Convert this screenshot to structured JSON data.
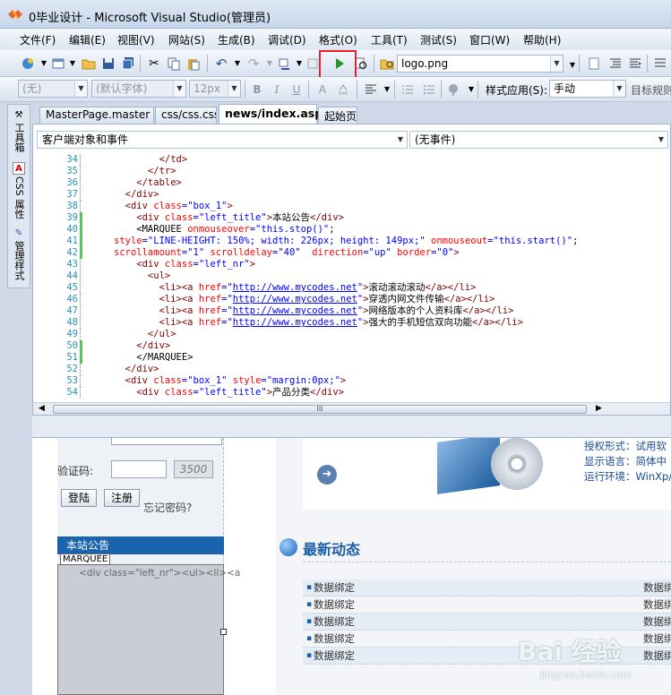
{
  "window": {
    "title": "0毕业设计 - Microsoft Visual Studio(管理员)"
  },
  "menu": {
    "items": [
      "文件(F)",
      "编辑(E)",
      "视图(V)",
      "网站(S)",
      "生成(B)",
      "调试(D)",
      "格式(O)",
      "工具(T)",
      "测试(S)",
      "窗口(W)",
      "帮助(H)"
    ]
  },
  "toolbar1": {
    "file_combo": "logo.png"
  },
  "toolbar2": {
    "block_combo": "(无)",
    "font_combo": "(默认字体)",
    "size_combo": "12px",
    "style_apply_label": "样式应用(S):",
    "style_apply_value": "手动",
    "target_rules_label": "目标规则"
  },
  "left_tabs": {
    "toolbox": "工具箱",
    "css_props": "CSS 属性",
    "manage_styles": "管理样式"
  },
  "doc_tabs": [
    "MasterPage.master",
    "css/css.css",
    "news/index.aspx",
    "起始页"
  ],
  "editor": {
    "object_combo": "客户端对象和事件",
    "event_combo": "(无事件)"
  },
  "code_lines": [
    {
      "n": "34",
      "parts": [
        {
          "c": "t",
          "s": "        </td>"
        }
      ]
    },
    {
      "n": "35",
      "parts": [
        {
          "c": "t",
          "s": "      </tr>"
        }
      ]
    },
    {
      "n": "36",
      "parts": [
        {
          "c": "t",
          "s": "    </table>"
        }
      ]
    },
    {
      "n": "37",
      "parts": [
        {
          "c": "t",
          "s": "  </div>"
        }
      ]
    },
    {
      "n": "38",
      "parts": [
        {
          "c": "t",
          "s": "  <div "
        },
        {
          "c": "a",
          "s": "class"
        },
        {
          "c": "v",
          "s": "=\"box_1\""
        },
        {
          "c": "t",
          "s": ">"
        }
      ]
    },
    {
      "n": "39",
      "parts": [
        {
          "c": "t",
          "s": "    <div "
        },
        {
          "c": "a",
          "s": "class"
        },
        {
          "c": "v",
          "s": "=\"left_title\""
        },
        {
          "c": "t",
          "s": ">"
        },
        {
          "c": "",
          "s": "本站公告"
        },
        {
          "c": "t",
          "s": "</div>"
        }
      ]
    },
    {
      "n": "40",
      "parts": [
        {
          "c": "",
          "s": "    <MARQUEE "
        },
        {
          "c": "a",
          "s": "onmouseover"
        },
        {
          "c": "v",
          "s": "=\"this.stop()\""
        },
        {
          "c": "",
          "s": ";"
        }
      ]
    },
    {
      "n": "41",
      "parts": [
        {
          "c": "a",
          "s": "style"
        },
        {
          "c": "v",
          "s": "=\"LINE-HEIGHT: 150%; width: 226px; height: 149px;\" "
        },
        {
          "c": "a",
          "s": "onmouseout"
        },
        {
          "c": "v",
          "s": "=\"this.start()\""
        },
        {
          "c": "",
          "s": ";"
        }
      ]
    },
    {
      "n": "42",
      "parts": [
        {
          "c": "a",
          "s": "scrollamount"
        },
        {
          "c": "v",
          "s": "=\"1\" "
        },
        {
          "c": "a",
          "s": "scrolldelay"
        },
        {
          "c": "v",
          "s": "=\"40\"  "
        },
        {
          "c": "a",
          "s": "direction"
        },
        {
          "c": "v",
          "s": "=\"up\" "
        },
        {
          "c": "a",
          "s": "border"
        },
        {
          "c": "v",
          "s": "=\"0\""
        },
        {
          "c": "t",
          "s": ">"
        }
      ]
    },
    {
      "n": "43",
      "parts": [
        {
          "c": "t",
          "s": "    <div "
        },
        {
          "c": "a",
          "s": "class"
        },
        {
          "c": "v",
          "s": "=\"left_nr\""
        },
        {
          "c": "t",
          "s": ">"
        }
      ]
    },
    {
      "n": "44",
      "parts": [
        {
          "c": "t",
          "s": "      <ul>"
        }
      ]
    },
    {
      "n": "45",
      "parts": [
        {
          "c": "t",
          "s": "        <li><a "
        },
        {
          "c": "a",
          "s": "href"
        },
        {
          "c": "v",
          "s": "=\""
        },
        {
          "c": "u",
          "s": "http://www.mycodes.net"
        },
        {
          "c": "v",
          "s": "\""
        },
        {
          "c": "t",
          "s": ">"
        },
        {
          "c": "",
          "s": "滚动滚动滚动"
        },
        {
          "c": "t",
          "s": "</a></li>"
        }
      ]
    },
    {
      "n": "46",
      "parts": [
        {
          "c": "t",
          "s": "        <li><a "
        },
        {
          "c": "a",
          "s": "href"
        },
        {
          "c": "v",
          "s": "=\""
        },
        {
          "c": "u",
          "s": "http://www.mycodes.net"
        },
        {
          "c": "v",
          "s": "\""
        },
        {
          "c": "t",
          "s": ">"
        },
        {
          "c": "",
          "s": "穿透内网文件传输"
        },
        {
          "c": "t",
          "s": "</a></li>"
        }
      ]
    },
    {
      "n": "47",
      "parts": [
        {
          "c": "t",
          "s": "        <li><a "
        },
        {
          "c": "a",
          "s": "href"
        },
        {
          "c": "v",
          "s": "=\""
        },
        {
          "c": "u",
          "s": "http://www.mycodes.net"
        },
        {
          "c": "v",
          "s": "\""
        },
        {
          "c": "t",
          "s": ">"
        },
        {
          "c": "",
          "s": "网络版本的个人资料库"
        },
        {
          "c": "t",
          "s": "</a></li>"
        }
      ]
    },
    {
      "n": "48",
      "parts": [
        {
          "c": "t",
          "s": "        <li><a "
        },
        {
          "c": "a",
          "s": "href"
        },
        {
          "c": "v",
          "s": "=\""
        },
        {
          "c": "u",
          "s": "http://www.mycodes.net"
        },
        {
          "c": "v",
          "s": "\""
        },
        {
          "c": "t",
          "s": ">"
        },
        {
          "c": "",
          "s": "强大的手机短信双向功能"
        },
        {
          "c": "t",
          "s": "</a></li>"
        }
      ]
    },
    {
      "n": "49",
      "parts": [
        {
          "c": "t",
          "s": "      </ul>"
        }
      ]
    },
    {
      "n": "50",
      "parts": [
        {
          "c": "t",
          "s": "    </div>"
        }
      ]
    },
    {
      "n": "51",
      "parts": [
        {
          "c": "",
          "s": "    </MARQUEE>"
        }
      ]
    },
    {
      "n": "52",
      "parts": [
        {
          "c": "t",
          "s": "  </div>"
        }
      ]
    },
    {
      "n": "53",
      "parts": [
        {
          "c": "t",
          "s": "  <div "
        },
        {
          "c": "a",
          "s": "class"
        },
        {
          "c": "v",
          "s": "=\"box_1\" "
        },
        {
          "c": "a",
          "s": "style"
        },
        {
          "c": "v",
          "s": "=\"margin:0px;\""
        },
        {
          "c": "t",
          "s": ">"
        }
      ]
    },
    {
      "n": "54",
      "parts": [
        {
          "c": "t",
          "s": "    <div "
        },
        {
          "c": "a",
          "s": "class"
        },
        {
          "c": "v",
          "s": "=\"left_title\""
        },
        {
          "c": "t",
          "s": ">"
        },
        {
          "c": "",
          "s": "产品分类"
        },
        {
          "c": "t",
          "s": "</div>"
        }
      ]
    }
  ],
  "design": {
    "captcha_label": "验证码:",
    "captcha_image": "3500",
    "login_btn": "登陆",
    "register_btn": "注册",
    "forgot_link": "忘记密码?",
    "notice_title": "本站公告",
    "marquee_tag": "MARQUEE",
    "marquee_content": "<div class=\"left_nr\"><ul><li><a",
    "spec_lines": [
      "授权形式：试用软",
      "显示语言：简体中",
      "运行环境：WinXp/"
    ],
    "news_title": "最新动态",
    "news_rows": [
      {
        "left": "数据绑定",
        "right": "数据绑"
      },
      {
        "left": "数据绑定",
        "right": "数据绑"
      },
      {
        "left": "数据绑定",
        "right": "数据绑"
      },
      {
        "left": "数据绑定",
        "right": "数据绑"
      },
      {
        "left": "数据绑定",
        "right": "数据绑"
      }
    ]
  },
  "watermark": {
    "logo": "Bai 经验",
    "url": "jingyan.baidu.com"
  },
  "colors": {
    "accent": "#1a63ad",
    "highlight_box": "#e8202a",
    "play_green": "#1a9a2a"
  }
}
